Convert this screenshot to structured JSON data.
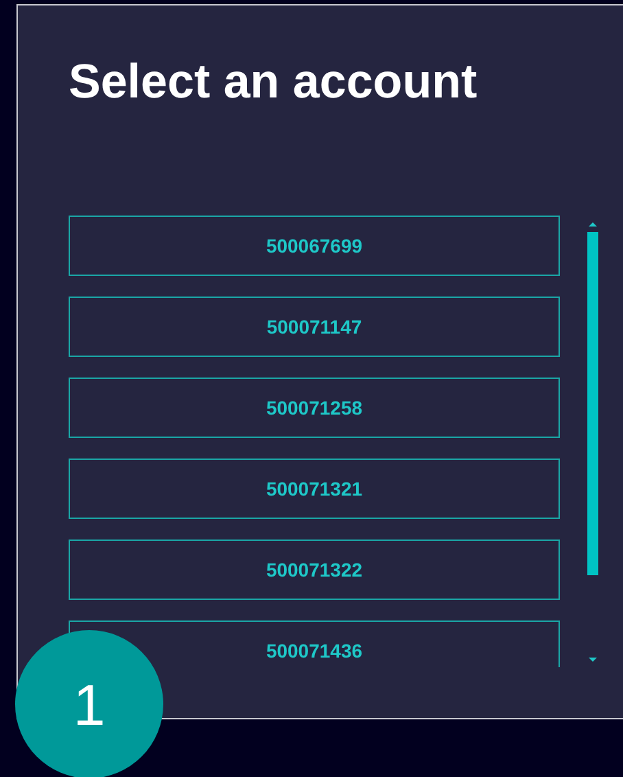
{
  "title": "Select an account",
  "accounts": [
    {
      "label": "500067699"
    },
    {
      "label": "500071147"
    },
    {
      "label": "500071258"
    },
    {
      "label": "500071321"
    },
    {
      "label": "500071322"
    },
    {
      "label": "500071436"
    }
  ],
  "step_badge": "1"
}
